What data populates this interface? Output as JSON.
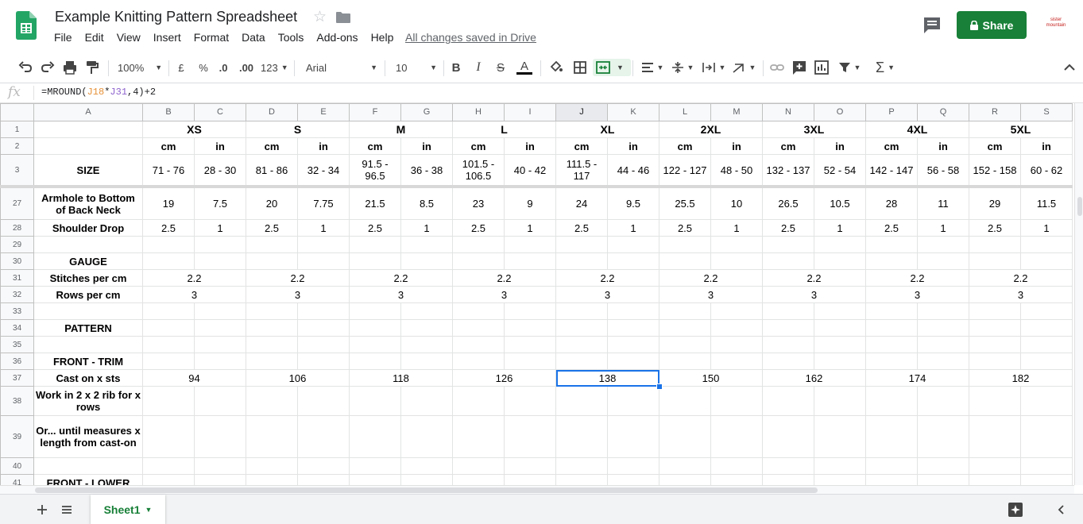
{
  "doc": {
    "title": "Example Knitting Pattern Spreadsheet",
    "saved_status": "All changes saved in Drive"
  },
  "menu": [
    "File",
    "Edit",
    "View",
    "Insert",
    "Format",
    "Data",
    "Tools",
    "Add-ons",
    "Help"
  ],
  "share": {
    "label": "Share"
  },
  "account": {
    "line1": "sister",
    "line2": "mountain"
  },
  "toolbar": {
    "zoom": "100%",
    "currency": "£",
    "percent": "%",
    "dec_decrease": ".0",
    "dec_increase": ".00",
    "more_formats": "123",
    "font": "Arial",
    "font_size": "10",
    "bold": "B",
    "italic": "I",
    "strikethrough": "S",
    "text_color_letter": "A"
  },
  "formula_bar": {
    "fx": "fx",
    "formula_parts": [
      "=MROUND(",
      "J18",
      "*",
      "J31",
      ",4)+2"
    ]
  },
  "columns": [
    "A",
    "B",
    "C",
    "D",
    "E",
    "F",
    "G",
    "H",
    "I",
    "J",
    "K",
    "L",
    "M",
    "N",
    "O",
    "P",
    "Q",
    "R",
    "S"
  ],
  "rows": [
    {
      "num": "1",
      "cells": [
        "",
        "XS",
        "",
        "S",
        "",
        "M",
        "",
        "L",
        "",
        "XL",
        "",
        "2XL",
        "",
        "3XL",
        "",
        "4XL",
        "",
        "5XL",
        ""
      ]
    },
    {
      "num": "2",
      "cells": [
        "",
        "cm",
        "in",
        "cm",
        "in",
        "cm",
        "in",
        "cm",
        "in",
        "cm",
        "in",
        "cm",
        "in",
        "cm",
        "in",
        "cm",
        "in",
        "cm",
        "in"
      ]
    },
    {
      "num": "3",
      "cells": [
        "SIZE",
        "71 - 76",
        "28 - 30",
        "81 - 86",
        "32 - 34",
        "91.5 - 96.5",
        "36 - 38",
        "101.5 - 106.5",
        "40 - 42",
        "111.5 - 117",
        "44 - 46",
        "122 - 127",
        "48 - 50",
        "132 - 137",
        "52 - 54",
        "142 - 147",
        "56 - 58",
        "152 - 158",
        "60 - 62"
      ]
    },
    {
      "num": "27",
      "cells": [
        "Armhole to Bottom of Back Neck",
        "19",
        "7.5",
        "20",
        "7.75",
        "21.5",
        "8.5",
        "23",
        "9",
        "24",
        "9.5",
        "25.5",
        "10",
        "26.5",
        "10.5",
        "28",
        "11",
        "29",
        "11.5"
      ]
    },
    {
      "num": "28",
      "cells": [
        "Shoulder Drop",
        "2.5",
        "1",
        "2.5",
        "1",
        "2.5",
        "1",
        "2.5",
        "1",
        "2.5",
        "1",
        "2.5",
        "1",
        "2.5",
        "1",
        "2.5",
        "1",
        "2.5",
        "1"
      ]
    },
    {
      "num": "29",
      "cells": [
        "",
        "",
        "",
        "",
        "",
        "",
        "",
        "",
        "",
        "",
        "",
        "",
        "",
        "",
        "",
        "",
        "",
        "",
        ""
      ]
    },
    {
      "num": "30",
      "cells": [
        "GAUGE",
        "",
        "",
        "",
        "",
        "",
        "",
        "",
        "",
        "",
        "",
        "",
        "",
        "",
        "",
        "",
        "",
        "",
        ""
      ]
    },
    {
      "num": "31",
      "cells": [
        "Stitches per cm",
        "2.2",
        "",
        "2.2",
        "",
        "2.2",
        "",
        "2.2",
        "",
        "2.2",
        "",
        "2.2",
        "",
        "2.2",
        "",
        "2.2",
        "",
        "2.2",
        ""
      ]
    },
    {
      "num": "32",
      "cells": [
        "Rows per cm",
        "3",
        "",
        "3",
        "",
        "3",
        "",
        "3",
        "",
        "3",
        "",
        "3",
        "",
        "3",
        "",
        "3",
        "",
        "3",
        ""
      ]
    },
    {
      "num": "33",
      "cells": [
        "",
        "",
        "",
        "",
        "",
        "",
        "",
        "",
        "",
        "",
        "",
        "",
        "",
        "",
        "",
        "",
        "",
        "",
        ""
      ]
    },
    {
      "num": "34",
      "cells": [
        "PATTERN",
        "",
        "",
        "",
        "",
        "",
        "",
        "",
        "",
        "",
        "",
        "",
        "",
        "",
        "",
        "",
        "",
        "",
        ""
      ]
    },
    {
      "num": "35",
      "cells": [
        "",
        "",
        "",
        "",
        "",
        "",
        "",
        "",
        "",
        "",
        "",
        "",
        "",
        "",
        "",
        "",
        "",
        "",
        ""
      ]
    },
    {
      "num": "36",
      "cells": [
        "FRONT - TRIM",
        "",
        "",
        "",
        "",
        "",
        "",
        "",
        "",
        "",
        "",
        "",
        "",
        "",
        "",
        "",
        "",
        "",
        ""
      ]
    },
    {
      "num": "37",
      "cells": [
        "Cast on x sts",
        "94",
        "",
        "106",
        "",
        "118",
        "",
        "126",
        "",
        "138",
        "",
        "150",
        "",
        "162",
        "",
        "174",
        "",
        "182",
        ""
      ]
    },
    {
      "num": "38",
      "cells": [
        "Work in 2 x 2 rib for x rows",
        "",
        "",
        "",
        "",
        "",
        "",
        "",
        "",
        "",
        "",
        "",
        "",
        "",
        "",
        "",
        "",
        "",
        ""
      ]
    },
    {
      "num": "39",
      "cells": [
        "Or... until measures x length from cast-on",
        "",
        "",
        "",
        "",
        "",
        "",
        "",
        "",
        "",
        "",
        "",
        "",
        "",
        "",
        "",
        "",
        "",
        ""
      ]
    },
    {
      "num": "40",
      "cells": [
        "",
        "",
        "",
        "",
        "",
        "",
        "",
        "",
        "",
        "",
        "",
        "",
        "",
        "",
        "",
        "",
        "",
        "",
        ""
      ]
    },
    {
      "num": "41",
      "cells": [
        "FRONT - LOWER",
        "",
        "",
        "",
        "",
        "",
        "",
        "",
        "",
        "",
        "",
        "",
        "",
        "",
        "",
        "",
        "",
        "",
        ""
      ]
    }
  ],
  "sheets": [
    {
      "label": "Sheet1"
    }
  ],
  "colors": {
    "accent": "#188038",
    "selection": "#1a73e8",
    "formula_ref1": "#e69138",
    "formula_ref2": "#8e63ce"
  }
}
